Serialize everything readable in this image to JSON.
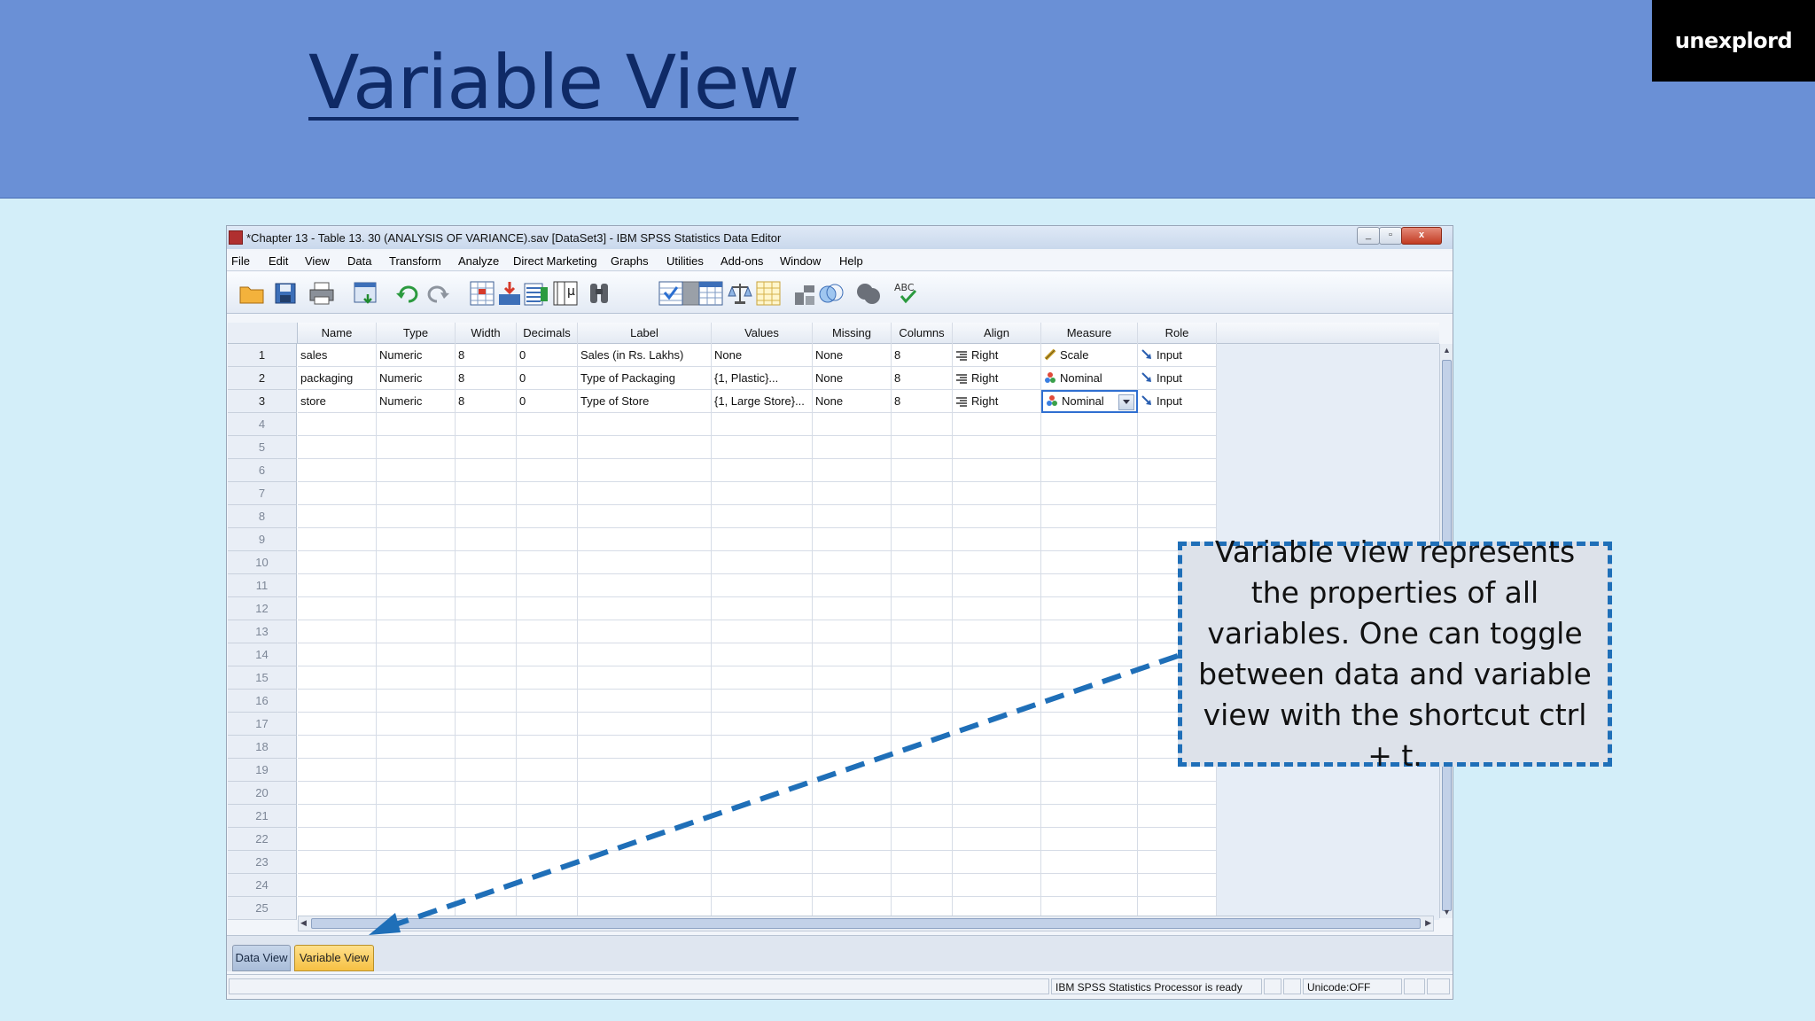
{
  "slide": {
    "title": "Variable View",
    "brand": "unexplord"
  },
  "window": {
    "title": "*Chapter 13 - Table 13. 30 (ANALYSIS OF VARIANCE).sav [DataSet3] - IBM SPSS Statistics Data Editor",
    "controls": [
      "_",
      "▫",
      "x"
    ]
  },
  "menu": [
    "File",
    "Edit",
    "View",
    "Data",
    "Transform",
    "Analyze",
    "Direct Marketing",
    "Graphs",
    "Utilities",
    "Add-ons",
    "Window",
    "Help"
  ],
  "toolbar": [
    "open-icon",
    "save-icon",
    "print-icon",
    "recall-dialog-icon",
    "undo-icon",
    "redo-icon",
    "goto-case-icon",
    "goto-variable-icon",
    "variables-icon",
    "run-descriptive-icon",
    "find-icon",
    "insert-cases-icon",
    "insert-variable-icon",
    "split-file-icon",
    "weight-cases-icon",
    "select-cases-icon",
    "value-labels-icon",
    "use-sets-icon",
    "show-all-icon",
    "spell-check-icon"
  ],
  "grid": {
    "columns": [
      "Name",
      "Type",
      "Width",
      "Decimals",
      "Label",
      "Values",
      "Missing",
      "Columns",
      "Align",
      "Measure",
      "Role"
    ],
    "rows": [
      {
        "num": "1",
        "name": "sales",
        "type": "Numeric",
        "width": "8",
        "decimals": "0",
        "label": "Sales (in Rs. Lakhs)",
        "values": "None",
        "missing": "None",
        "columns": "8",
        "align": "Right",
        "measure": "Scale",
        "role": "Input"
      },
      {
        "num": "2",
        "name": "packaging",
        "type": "Numeric",
        "width": "8",
        "decimals": "0",
        "label": "Type of Packaging",
        "values": "{1, Plastic}...",
        "missing": "None",
        "columns": "8",
        "align": "Right",
        "measure": "Nominal",
        "role": "Input"
      },
      {
        "num": "3",
        "name": "store",
        "type": "Numeric",
        "width": "8",
        "decimals": "0",
        "label": "Type of Store",
        "values": "{1, Large Store}...",
        "missing": "None",
        "columns": "8",
        "align": "Right",
        "measure": "Nominal",
        "role": "Input"
      }
    ],
    "empty_rows": [
      "4",
      "5",
      "6",
      "7",
      "8",
      "9",
      "10",
      "11",
      "12",
      "13",
      "14",
      "15",
      "16",
      "17",
      "18",
      "19",
      "20",
      "21",
      "22",
      "23",
      "24",
      "25"
    ]
  },
  "tabs": {
    "data_view": "Data View",
    "variable_view": "Variable View"
  },
  "status": {
    "processor": "IBM SPSS Statistics Processor is ready",
    "unicode": "Unicode:OFF"
  },
  "callout": {
    "text": "Variable view represents the properties of all variables. One can toggle between data and variable view with the shortcut ctrl + t."
  },
  "colors": {
    "banner": "#6a90d6",
    "title": "#0f2a66",
    "callout_border": "#1f6fb8",
    "active_tab": "#f6c043"
  }
}
